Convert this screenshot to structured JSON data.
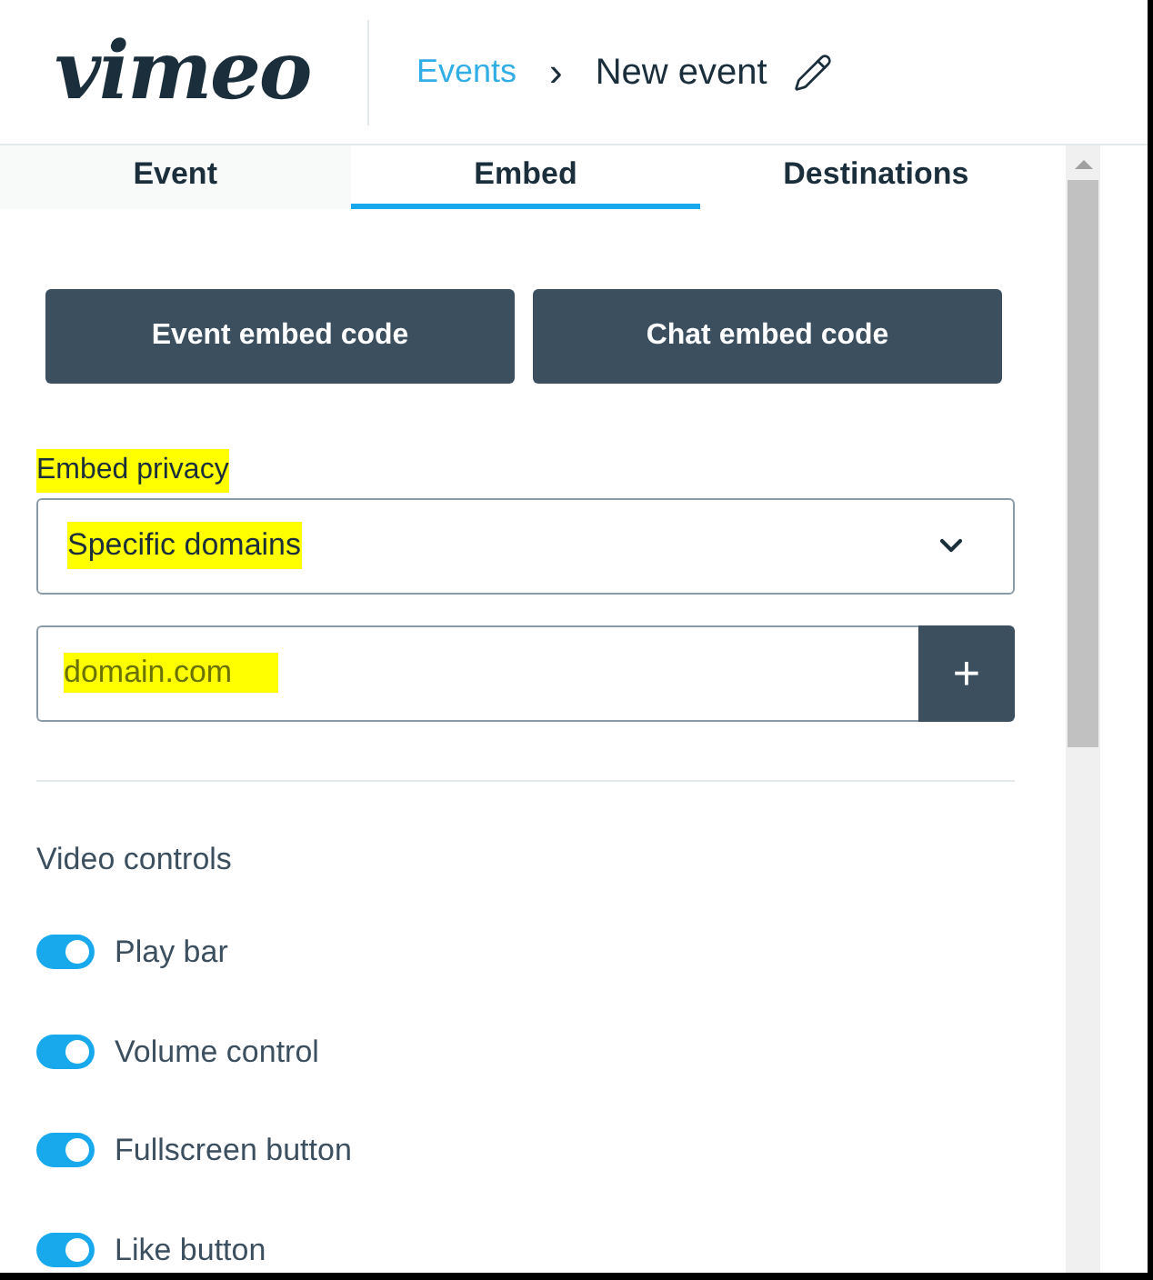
{
  "header": {
    "logo": "vimeo",
    "breadcrumb": [
      {
        "label": "Events",
        "kind": "link"
      },
      {
        "label": "New event",
        "kind": "current"
      }
    ],
    "separator": "›"
  },
  "tabs": [
    {
      "label": "Event",
      "selected": false
    },
    {
      "label": "Embed",
      "selected": true
    },
    {
      "label": "Destinations",
      "selected": false
    }
  ],
  "buttons": [
    "Event embed code",
    "Chat embed code"
  ],
  "privacy": {
    "label": "Embed privacy",
    "label_highlighted": true,
    "value": "Specific domains",
    "value_highlighted": true
  },
  "domain": {
    "placeholder": "domain.com",
    "placeholder_highlighted": true,
    "add": "+"
  },
  "video_controls": {
    "title": "Video controls",
    "items": [
      {
        "label": "Play bar",
        "on": true
      },
      {
        "label": "Volume control",
        "on": true
      },
      {
        "label": "Fullscreen button",
        "on": true
      },
      {
        "label": "Like button",
        "on": true
      }
    ]
  }
}
